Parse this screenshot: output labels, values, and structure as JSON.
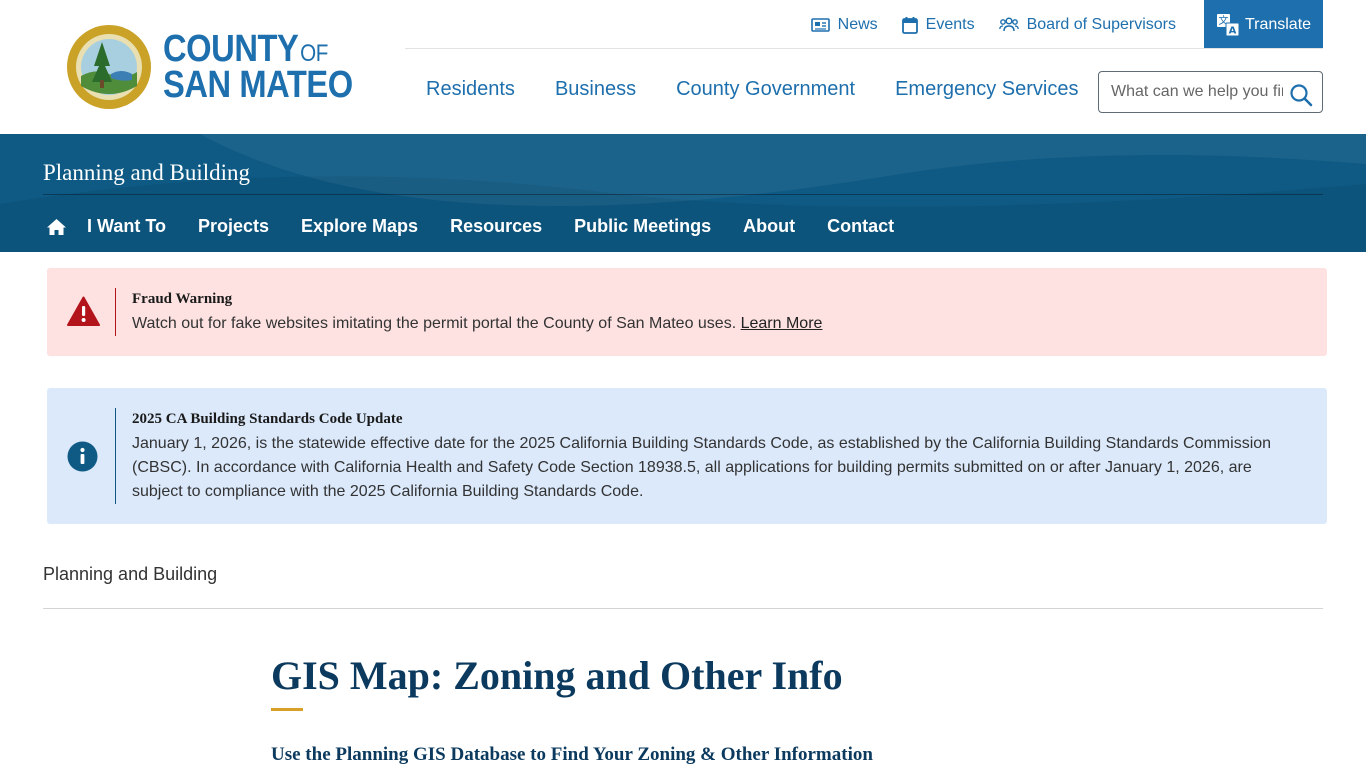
{
  "header": {
    "logo": {
      "line1": "COUNTY",
      "of": "OF",
      "line2": "SAN MATEO"
    },
    "utility": [
      {
        "label": "News",
        "icon": "newspaper-icon"
      },
      {
        "label": "Events",
        "icon": "calendar-icon"
      },
      {
        "label": "Board of Supervisors",
        "icon": "people-icon"
      }
    ],
    "translate_label": "Translate",
    "nav": [
      "Residents",
      "Business",
      "County Government",
      "Emergency Services"
    ],
    "search": {
      "placeholder": "What can we help you find?"
    }
  },
  "department": {
    "title": "Planning and Building",
    "subnav": [
      "I Want To",
      "Projects",
      "Explore Maps",
      "Resources",
      "Public Meetings",
      "About",
      "Contact"
    ]
  },
  "alerts": {
    "fraud": {
      "title": "Fraud Warning",
      "text": "Watch out for fake websites imitating the permit portal the County of San Mateo uses.",
      "link": "Learn More",
      "icon": "warning-triangle-icon"
    },
    "code": {
      "title": "2025 CA Building Standards Code Update",
      "text": "January 1, 2026, is the statewide effective date for the 2025 California Building Standards Code, as established by the California Building Standards Commission (CBSC). In accordance with California Health and Safety Code Section 18938.5, all applications for building permits submitted on or after January 1, 2026, are subject to compliance with the 2025 California Building Standards Code.",
      "icon": "info-circle-icon"
    }
  },
  "breadcrumb": "Planning and Building",
  "page": {
    "title": "GIS Map: Zoning and Other Info",
    "subtitle": "Use the Planning GIS Database to Find Your Zoning & Other Information"
  },
  "colors": {
    "brand_blue": "#1e6fad",
    "banner_blue": "#0e5a84",
    "title_navy": "#0b3a5e",
    "accent_gold": "#d9a028",
    "alert_red_bg": "#fde2e1",
    "alert_red": "#b3141b",
    "alert_blue_bg": "#dbe9fb",
    "alert_blue": "#0e5a84"
  }
}
